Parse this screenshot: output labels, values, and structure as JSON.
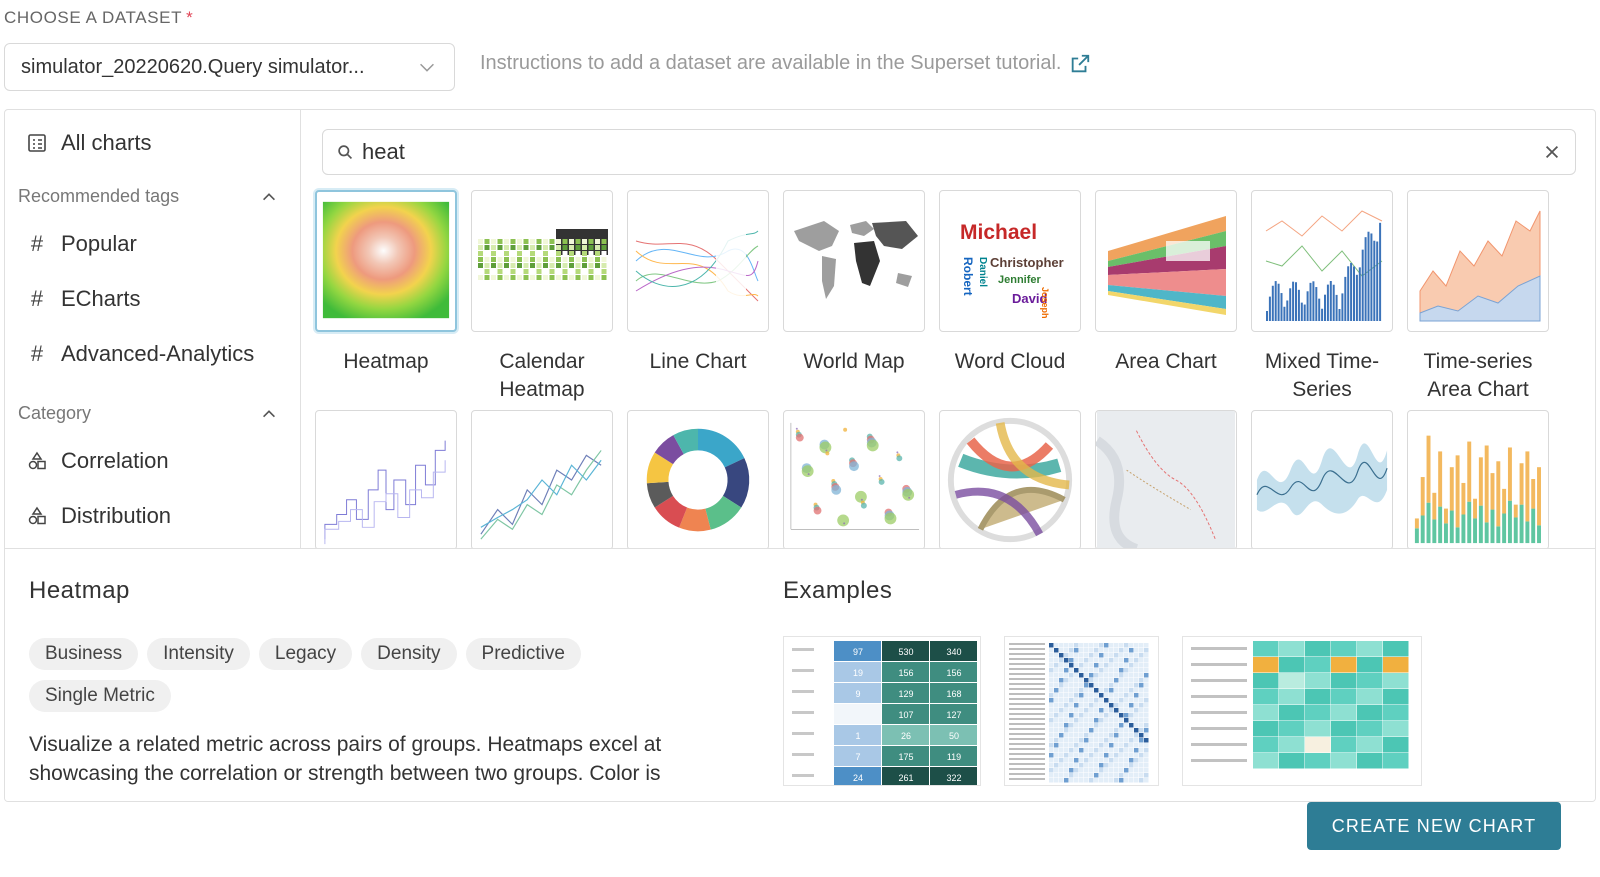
{
  "dataset": {
    "label": "CHOOSE A DATASET",
    "required_mark": "*",
    "selected": "simulator_20220620.Query simulator...",
    "instructions": "Instructions to add a dataset are available in the Superset tutorial."
  },
  "sidebar": {
    "all_charts": "All charts",
    "recommended_heading": "Recommended tags",
    "tags": [
      "Popular",
      "ECharts",
      "Advanced-Analytics"
    ],
    "category_heading": "Category",
    "categories": [
      "Correlation",
      "Distribution"
    ]
  },
  "search": {
    "value": "heat"
  },
  "gallery": {
    "row1": [
      "Heatmap",
      "Calendar Heatmap",
      "Line Chart",
      "World Map",
      "Word Cloud",
      "Area Chart",
      "Mixed Time-Series",
      "Time-series Area Chart"
    ],
    "selected": "Heatmap",
    "wordcloud_words": [
      "Michael",
      "Christopher",
      "Jennifer",
      "David",
      "Robert",
      "Joseph",
      "Daniel"
    ]
  },
  "detail": {
    "title": "Heatmap",
    "tags": [
      "Business",
      "Intensity",
      "Legacy",
      "Density",
      "Predictive",
      "Single Metric"
    ],
    "description": "Visualize a related metric across pairs of groups. Heatmaps excel at showcasing the correlation or strength between two groups. Color is",
    "examples_title": "Examples",
    "example1_values": [
      [
        "97",
        "530",
        "340"
      ],
      [
        "19",
        "156",
        "156"
      ],
      [
        "9",
        "129",
        "168"
      ],
      [
        "",
        "107",
        "127"
      ],
      [
        "1",
        "26",
        "50"
      ],
      [
        "7",
        "175",
        "119"
      ],
      [
        "24",
        "261",
        "322"
      ]
    ]
  },
  "footer": {
    "create_label": "CREATE NEW CHART"
  },
  "colors": {
    "primary_button": "#2e7d95",
    "selected_border": "#8fc5dd",
    "required": "#e04355"
  }
}
